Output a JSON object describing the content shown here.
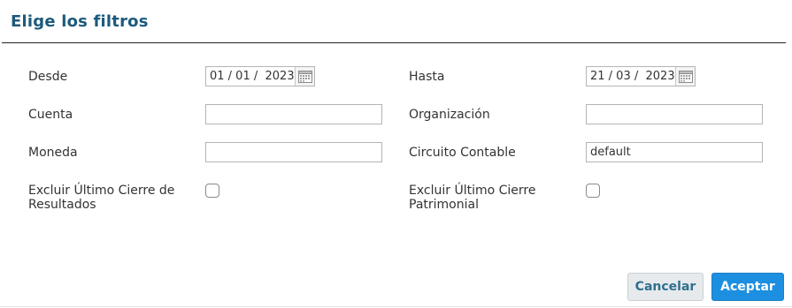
{
  "dialog": {
    "title": "Elige los filtros"
  },
  "filters": {
    "desde": {
      "label": "Desde",
      "value": "01 / 01 /  2023"
    },
    "hasta": {
      "label": "Hasta",
      "value": "21 / 03 /  2023"
    },
    "cuenta": {
      "label": "Cuenta",
      "value": ""
    },
    "organizacion": {
      "label": "Organización",
      "value": ""
    },
    "moneda": {
      "label": "Moneda",
      "value": ""
    },
    "circuito": {
      "label": "Circuito Contable",
      "value": "default"
    },
    "excluir_resultados": {
      "label_line1": "Excluir Último Cierre de",
      "label_line2": "Resultados",
      "checked": false
    },
    "excluir_patrimonial": {
      "label_line1": "Excluir Último Cierre",
      "label_line2": "Patrimonial",
      "checked": false
    }
  },
  "buttons": {
    "cancel": "Cancelar",
    "accept": "Aceptar"
  },
  "icons": {
    "date_picker": "calendar-icon"
  },
  "colors": {
    "title": "#1d5a7c",
    "accept_bg": "#1c8fe0",
    "cancel_bg": "#e7eaec"
  }
}
